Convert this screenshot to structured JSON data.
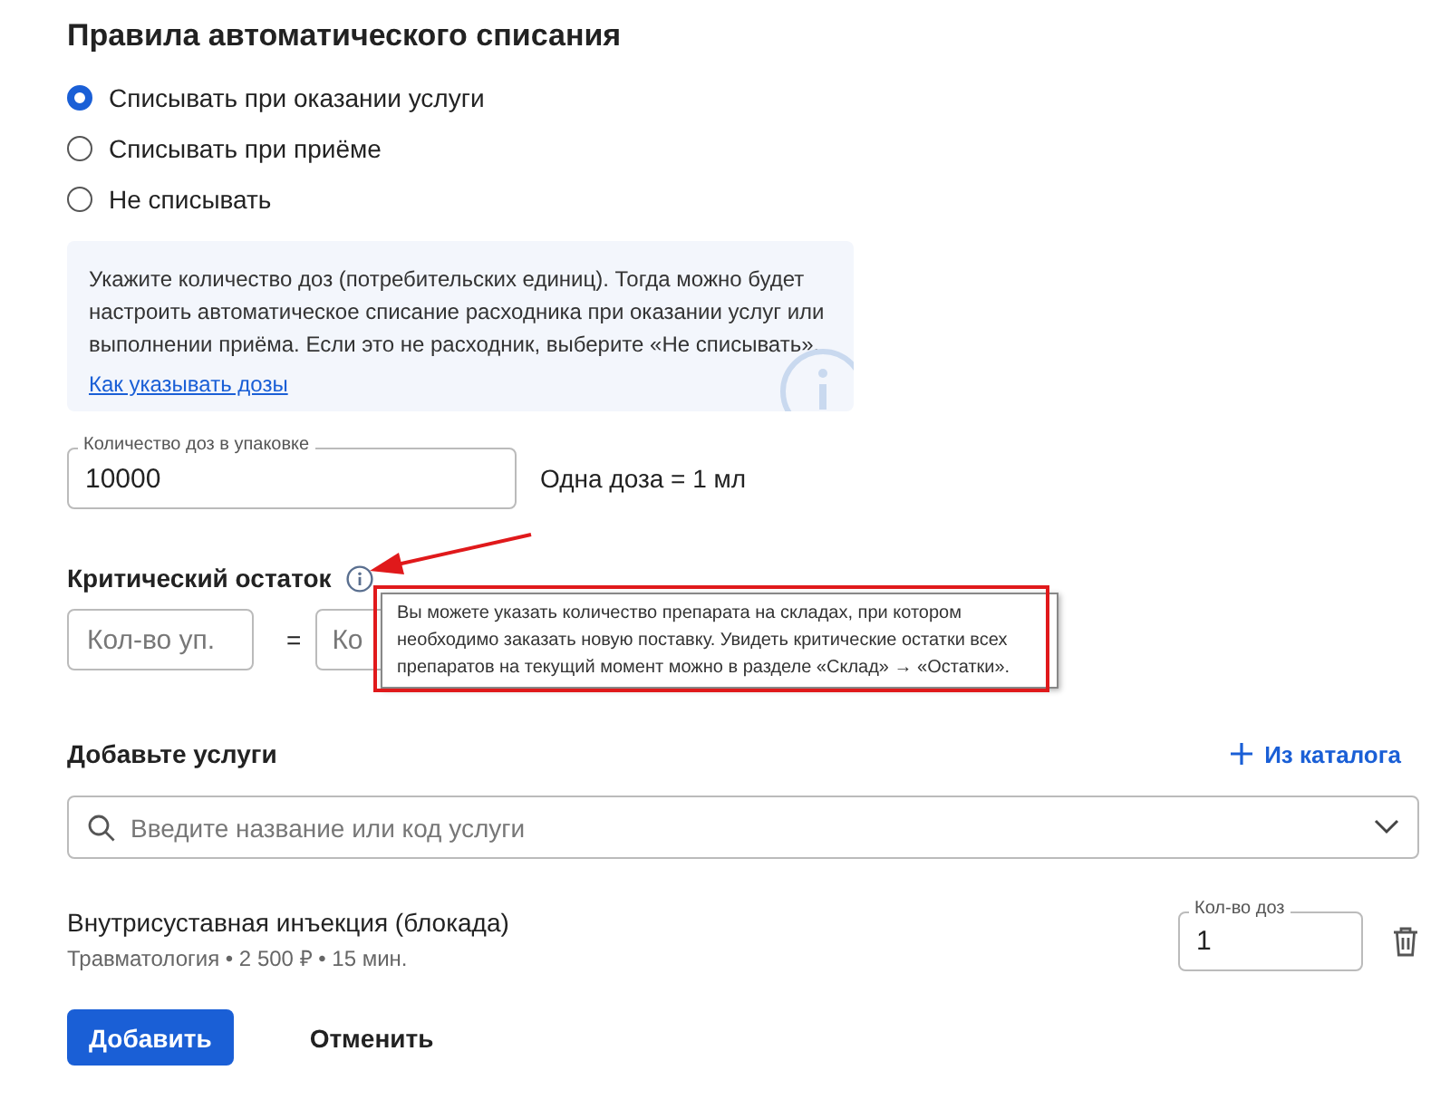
{
  "title": "Правила автоматического списания",
  "write_off_options": [
    {
      "label": "Списывать при оказании услуги",
      "selected": true
    },
    {
      "label": "Списывать при приёме",
      "selected": false
    },
    {
      "label": "Не списывать",
      "selected": false
    }
  ],
  "info": {
    "text": "Укажите количество доз (потребительских единиц). Тогда можно будет настроить автоматическое списание расходника при оказании услуг или выполнении приёма. Если это не расходник, выберите «Не списывать».",
    "link": "Как указывать дозы"
  },
  "doses_field": {
    "label": "Количество доз в упаковке",
    "value": "10000"
  },
  "dose_note": "Одна доза = 1 мл",
  "critical": {
    "title": "Критический остаток",
    "packs_placeholder": "Кол-во уп.",
    "equals": "=",
    "doses_placeholder": "Ко",
    "tooltip": "Вы можете указать количество препарата на складах, при котором необходимо заказать новую поставку. Увидеть критические остатки всех препаратов на текущий момент можно в разделе «Склад» → «Остатки».",
    "annotated": true
  },
  "services": {
    "title": "Добавьте услуги",
    "catalog_button": "Из каталога",
    "search_placeholder": "Введите название или код услуги",
    "items": [
      {
        "name": "Внутрисуставная инъекция (блокада)",
        "details": "Травматология • 2 500 ₽ • 15 мин.",
        "qty_label": "Кол-во доз",
        "qty": "1"
      }
    ]
  },
  "buttons": [
    {
      "label": "Добавить",
      "kind": "primary"
    },
    {
      "label": "Отменить",
      "kind": "plain"
    }
  ]
}
